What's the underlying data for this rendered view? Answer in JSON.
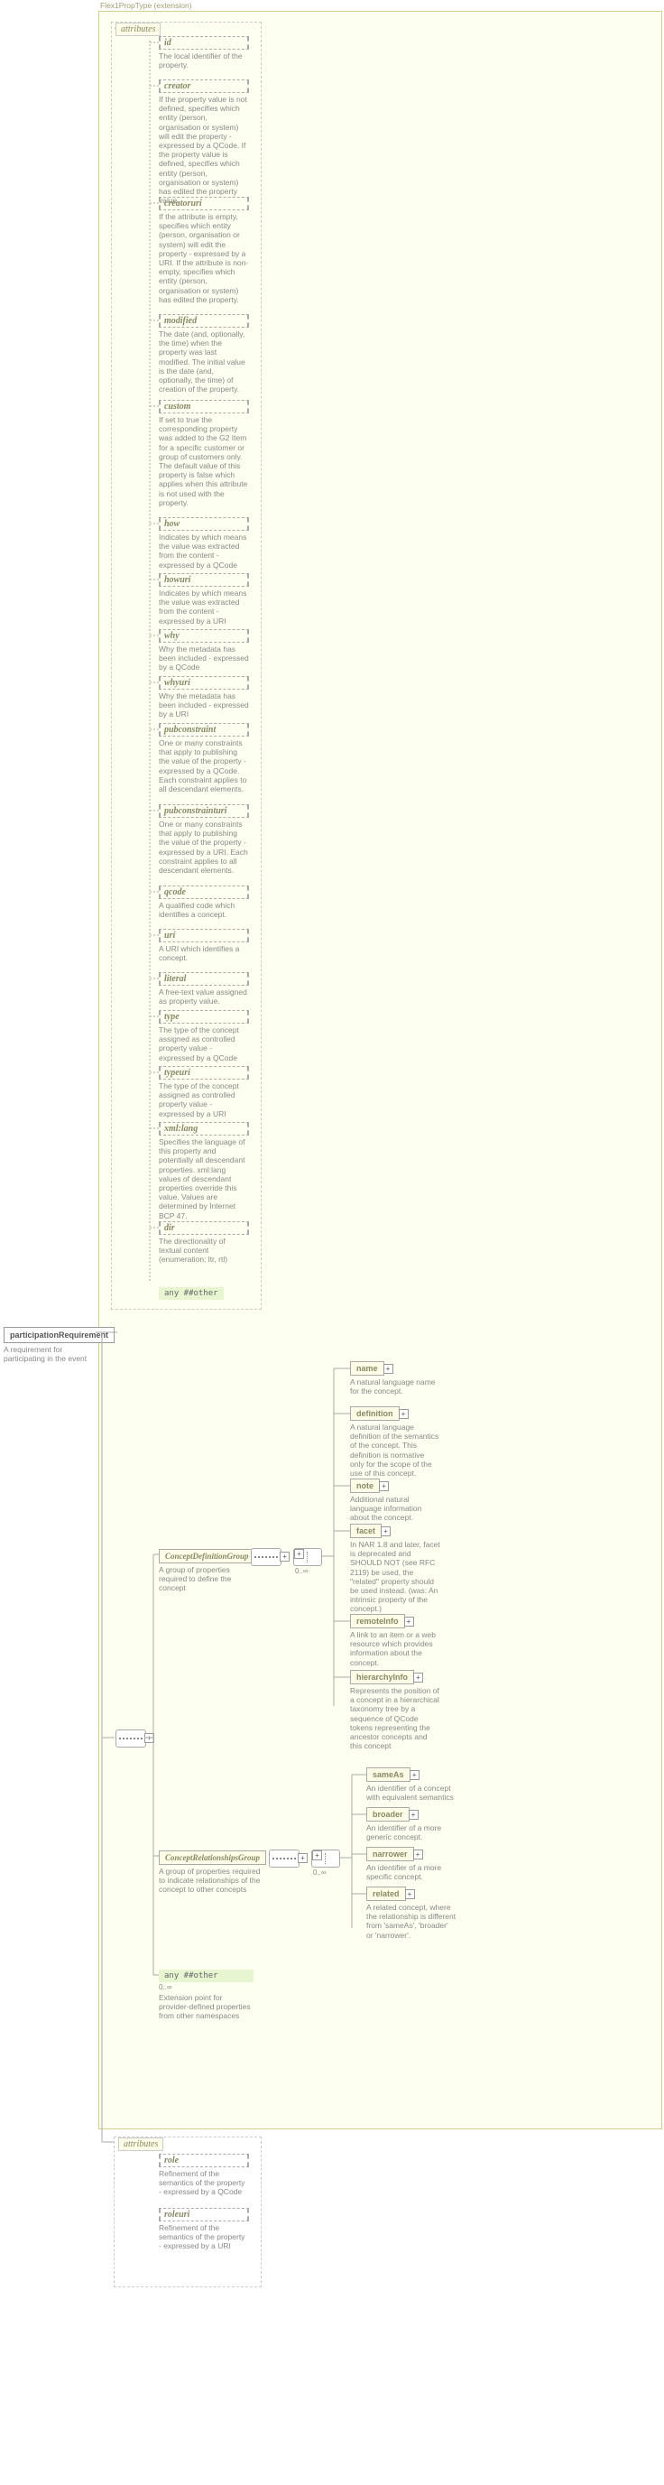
{
  "extension": {
    "label": "Flex1PropType (extension)",
    "attributesLabel": "attributes"
  },
  "mainElement": {
    "name": "participationRequirement",
    "desc": "A requirement for participating in the event"
  },
  "occ": {
    "unbounded": "0..∞"
  },
  "anyAttr": {
    "label": "any ##other"
  },
  "anyElem": {
    "label": "any ##other",
    "desc": "Extension point for provider-defined properties from other namespaces"
  },
  "attributes": [
    {
      "name": "id",
      "desc": "The local identifier of the property."
    },
    {
      "name": "creator",
      "desc": "If the property value is not defined, specifies which entity (person, organisation or system) will edit the property - expressed by a QCode. If the property value is defined, specifies which entity (person, organisation or system) has edited the property value."
    },
    {
      "name": "creatoruri",
      "desc": "If the attribute is empty, specifies which entity (person, organisation or system) will edit the property - expressed by a URI. If the attribute is non-empty, specifies which entity (person, organisation or system) has edited the property."
    },
    {
      "name": "modified",
      "desc": "The date (and, optionally, the time) when the property was last modified. The initial value is the date (and, optionally, the time) of creation of the property."
    },
    {
      "name": "custom",
      "desc": "If set to true the corresponding property was added to the G2 Item for a specific customer or group of customers only. The default value of this property is false which applies when this attribute is not used with the property."
    },
    {
      "name": "how",
      "desc": "Indicates by which means the value was extracted from the content - expressed by a QCode"
    },
    {
      "name": "howuri",
      "desc": "Indicates by which means the value was extracted from the content - expressed by a URI"
    },
    {
      "name": "why",
      "desc": "Why the metadata has been included - expressed by a QCode"
    },
    {
      "name": "whyuri",
      "desc": "Why the metadata has been included - expressed by a URI"
    },
    {
      "name": "pubconstraint",
      "desc": "One or many constraints that apply to publishing the value of the property - expressed by a QCode. Each constraint applies to all descendant elements."
    },
    {
      "name": "pubconstrainturi",
      "desc": "One or many constraints that apply to publishing the value of the property - expressed by a URI. Each constraint applies to all descendant elements."
    },
    {
      "name": "qcode",
      "desc": "A qualified code which identifies a concept."
    },
    {
      "name": "uri",
      "desc": "A URI which identifies a concept."
    },
    {
      "name": "literal",
      "desc": "A free-text value assigned as property value."
    },
    {
      "name": "type",
      "desc": "The type of the concept assigned as controlled property value - expressed by a QCode"
    },
    {
      "name": "typeuri",
      "desc": "The type of the concept assigned as controlled property value - expressed by a URI"
    },
    {
      "name": "xml:lang",
      "desc": "Specifies the language of this property and potentially all descendant properties. xml:lang values of descendant properties override this value. Values are determined by Internet BCP 47.",
      "prefix": "xml:"
    },
    {
      "name": "dir",
      "desc": "The directionality of textual content (enumeration: ltr, rtl)"
    }
  ],
  "attributes2": [
    {
      "name": "role",
      "desc": "Refinement of the semantics of the property - expressed by a QCode"
    },
    {
      "name": "roleuri",
      "desc": "Refinement of the semantics of the property - expressed by a URI"
    }
  ],
  "groups": {
    "def": {
      "name": "ConceptDefinitionGroup",
      "desc": "A group of properties required to define the concept"
    },
    "rel": {
      "name": "ConceptRelationshipsGroup",
      "desc": "A group of properties required to indicate relationships of the concept to other concepts"
    }
  },
  "cdg": [
    {
      "name": "name",
      "desc": "A natural language name for the concept."
    },
    {
      "name": "definition",
      "desc": "A natural language definition of the semantics of the concept. This definition is normative only for the scope of the use of this concept."
    },
    {
      "name": "note",
      "desc": "Additional natural language information about the concept."
    },
    {
      "name": "facet",
      "desc": "In NAR 1.8 and later, facet is deprecated and SHOULD NOT (see RFC 2119) be used, the \"related\" property should be used instead. (was: An intrinsic property of the concept.)"
    },
    {
      "name": "remoteInfo",
      "desc": "A link to an item or a web resource which provides information about the concept."
    },
    {
      "name": "hierarchyInfo",
      "desc": "Represents the position of a concept in a hierarchical taxonomy tree by a sequence of QCode tokens representing the ancestor concepts and this concept"
    }
  ],
  "crg": [
    {
      "name": "sameAs",
      "desc": "An identifier of a concept with equivalent semantics"
    },
    {
      "name": "broader",
      "desc": "An identifier of a more generic concept."
    },
    {
      "name": "narrower",
      "desc": "An identifier of a more specific concept."
    },
    {
      "name": "related",
      "desc": "A related concept, where the relationship is different from 'sameAs', 'broader' or 'narrower'."
    }
  ]
}
